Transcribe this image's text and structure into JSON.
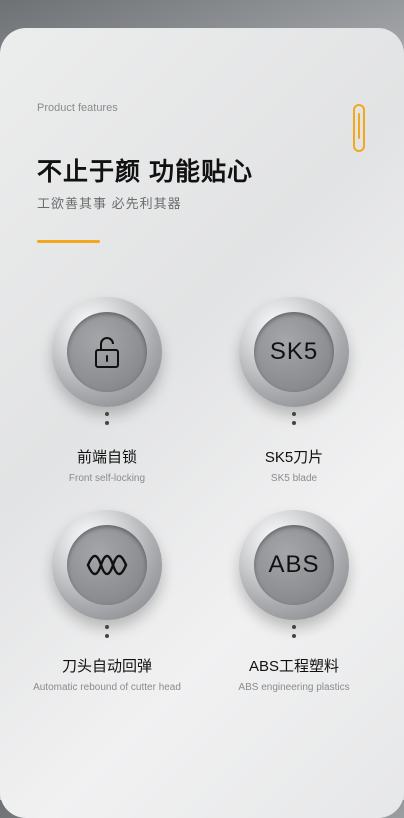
{
  "header": {
    "eyebrow": "Product features",
    "title": "不止于颜 功能贴心",
    "subtitle": "工欲善其事 必先利其器"
  },
  "colors": {
    "accent": "#f3a81c"
  },
  "features": [
    {
      "icon": "unlocked-padlock-icon",
      "label": "前端自锁",
      "sublabel": "Front self-locking"
    },
    {
      "icon_text": "SK5",
      "label": "SK5刀片",
      "sublabel": "SK5 blade"
    },
    {
      "icon": "spring-wave-icon",
      "label": "刀头自动回弹",
      "sublabel": "Automatic rebound of cutter head"
    },
    {
      "icon_text": "ABS",
      "label": "ABS工程塑料",
      "sublabel": "ABS engineering plastics"
    }
  ]
}
